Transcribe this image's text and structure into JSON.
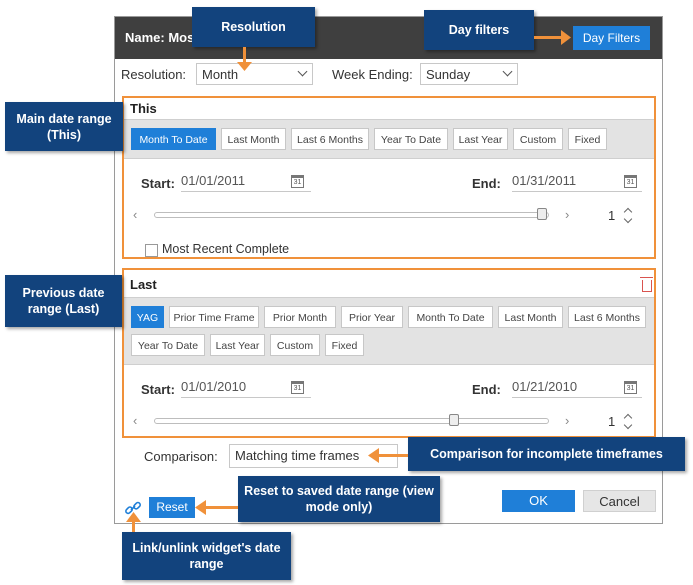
{
  "dialog": {
    "name_label": "Name: Mos",
    "day_filters_label": "Day Filters",
    "resolution_label": "Resolution:",
    "resolution_value": "Month",
    "week_ending_label": "Week Ending:",
    "week_ending_value": "Sunday",
    "ok_label": "OK",
    "cancel_label": "Cancel",
    "reset_label": "Reset",
    "comparison_label": "Comparison:",
    "comparison_value": "Matching time frames"
  },
  "this_section": {
    "title": "This",
    "buttons": [
      "Month To Date",
      "Last Month",
      "Last 6 Months",
      "Year To Date",
      "Last Year",
      "Custom",
      "Fixed"
    ],
    "active_index": 0,
    "start_label": "Start:",
    "start_value": "01/01/2011",
    "end_label": "End:",
    "end_value": "01/31/2011",
    "calendar_icon_text": "31",
    "spinner_value": "1",
    "slider_value": 1.0,
    "checkbox_label": "Most Recent Complete"
  },
  "last_section": {
    "title": "Last",
    "buttons_row1": [
      "YAG",
      "Prior Time Frame",
      "Prior Month",
      "Prior Year",
      "Month To Date",
      "Last Month",
      "Last 6 Months"
    ],
    "buttons_row2": [
      "Year To Date",
      "Last Year",
      "Custom",
      "Fixed"
    ],
    "active_index": 0,
    "start_label": "Start:",
    "start_value": "01/01/2010",
    "end_label": "End:",
    "end_value": "01/21/2010",
    "calendar_icon_text": "31",
    "spinner_value": "1",
    "slider_value": 0.77
  },
  "callouts": {
    "resolution": "Resolution",
    "day_filters": "Day filters",
    "main_range": "Main date range (This)",
    "previous_range": "Previous date range (Last)",
    "comparison": "Comparison for incomplete timeframes",
    "reset": "Reset to saved date range (view mode only)",
    "link": "Link/unlink widget's date range"
  },
  "colors": {
    "accent_blue": "#1f7fd8",
    "callout_navy": "#12437d",
    "highlight_orange": "#f0913a",
    "header_dark": "#3f3f3f"
  }
}
